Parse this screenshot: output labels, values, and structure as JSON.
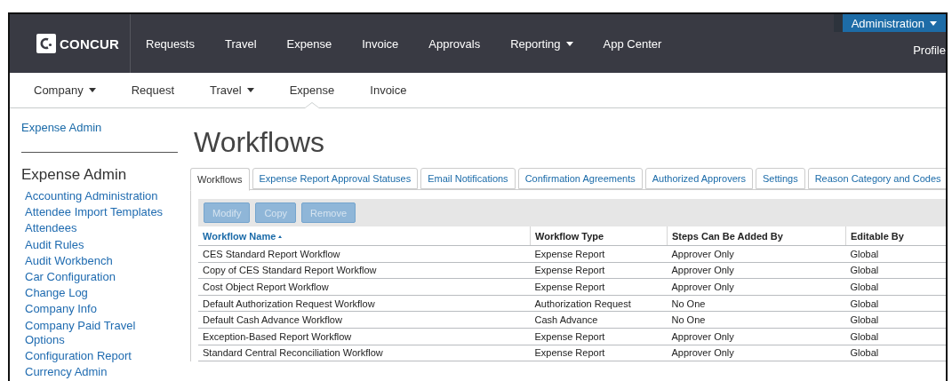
{
  "top_nav": {
    "logo": "CONCUR",
    "items": [
      {
        "label": "Requests",
        "dropdown": false
      },
      {
        "label": "Travel",
        "dropdown": false
      },
      {
        "label": "Expense",
        "dropdown": false
      },
      {
        "label": "Invoice",
        "dropdown": false
      },
      {
        "label": "Approvals",
        "dropdown": false
      },
      {
        "label": "Reporting",
        "dropdown": true
      },
      {
        "label": "App Center",
        "dropdown": false
      }
    ],
    "admin_menu": "Administration",
    "profile": "Profile"
  },
  "sub_nav": [
    {
      "label": "Company",
      "dropdown": true,
      "selected": false
    },
    {
      "label": "Request",
      "dropdown": false,
      "selected": false
    },
    {
      "label": "Travel",
      "dropdown": true,
      "selected": false
    },
    {
      "label": "Expense",
      "dropdown": false,
      "selected": true
    },
    {
      "label": "Invoice",
      "dropdown": false,
      "selected": false
    }
  ],
  "sidebar": {
    "link": "Expense Admin",
    "heading": "Expense Admin",
    "items": [
      "Accounting Administration",
      "Attendee Import Templates",
      "Attendees",
      "Audit Rules",
      "Audit Workbench",
      "Car Configuration",
      "Change Log",
      "Company Info",
      "Company Paid Travel Options",
      "Configuration Report",
      "Currency Admin"
    ]
  },
  "page_title": "Workflows",
  "tabs": [
    {
      "label": "Workflows",
      "selected": true
    },
    {
      "label": "Expense Report Approval Statuses",
      "selected": false
    },
    {
      "label": "Email Notifications",
      "selected": false
    },
    {
      "label": "Confirmation Agreements",
      "selected": false
    },
    {
      "label": "Authorized Approvers",
      "selected": false
    },
    {
      "label": "Settings",
      "selected": false
    },
    {
      "label": "Reason Category and Codes",
      "selected": false
    }
  ],
  "toolbar": [
    {
      "label": "Modify",
      "disabled": true
    },
    {
      "label": "Copy",
      "disabled": true
    },
    {
      "label": "Remove",
      "disabled": true
    }
  ],
  "table": {
    "columns": [
      {
        "label": "Workflow Name",
        "sorted": true
      },
      {
        "label": "Workflow Type",
        "sorted": false
      },
      {
        "label": "Steps Can Be Added By",
        "sorted": false
      },
      {
        "label": "Editable By",
        "sorted": false
      }
    ],
    "rows": [
      [
        "CES Standard Report Workflow",
        "Expense Report",
        "Approver Only",
        "Global"
      ],
      [
        "Copy of CES Standard Report Workflow",
        "Expense Report",
        "Approver Only",
        "Global"
      ],
      [
        "Cost Object Report Workflow",
        "Expense Report",
        "Approver Only",
        "Global"
      ],
      [
        "Default Authorization Request Workflow",
        "Authorization Request",
        "No One",
        "Global"
      ],
      [
        "Default Cash Advance Workflow",
        "Cash Advance",
        "No One",
        "Global"
      ],
      [
        "Exception-Based Report Workflow",
        "Expense Report",
        "Approver Only",
        "Global"
      ],
      [
        "Standard Central Reconciliation Workflow",
        "Expense Report",
        "Approver Only",
        "Global"
      ]
    ]
  }
}
